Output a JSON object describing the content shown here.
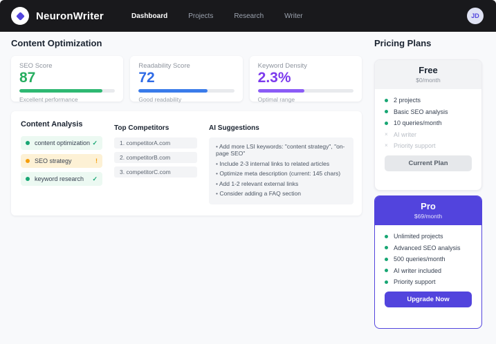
{
  "colors": {
    "accent": "#5244dd",
    "warn": "#f59e0b"
  },
  "navbar": {
    "brand": "NeuronWriter",
    "items": [
      {
        "label": "Dashboard",
        "active": true
      },
      {
        "label": "Projects",
        "active": false
      },
      {
        "label": "Research",
        "active": false
      },
      {
        "label": "Writer",
        "active": false
      }
    ],
    "avatar": "JD"
  },
  "main": {
    "title": "Content Optimization",
    "score_cards": [
      {
        "label": "SEO Score",
        "value": "87",
        "caption": "Excellent performance",
        "percent": 87,
        "bar_color": "#2eb872",
        "value_color": "#27ae60"
      },
      {
        "label": "Readability Score",
        "value": "72",
        "caption": "Good readability",
        "percent": 72,
        "bar_color": "#3a7bea",
        "value_color": "#2f6be6"
      },
      {
        "label": "Keyword Density",
        "value": "2.3%",
        "caption": "Optimal range",
        "percent": 49,
        "bar_color": "#8b5cf6",
        "value_color": "#7c3aed"
      }
    ],
    "analysis": {
      "title": "Content Analysis",
      "keywords": [
        {
          "label": "content optimization",
          "status": "ok",
          "marker": "✓"
        },
        {
          "label": "SEO strategy",
          "status": "warn",
          "marker": "!"
        },
        {
          "label": "keyword research",
          "status": "ok",
          "marker": "✓"
        }
      ],
      "competitors": {
        "title": "Top Competitors",
        "items": [
          "1. competitorA.com",
          "2. competitorB.com",
          "3. competitorC.com"
        ]
      },
      "suggestions": {
        "title": "AI Suggestions",
        "items": [
          "Add more LSI keywords: \"content strategy\", \"on-page SEO\"",
          "Include 2-3 internal links to related articles",
          "Optimize meta description (current: 145 chars)",
          "Add 1-2 relevant external links",
          "Consider adding a FAQ section"
        ]
      }
    }
  },
  "pricing": {
    "title": "Pricing Plans",
    "plans": [
      {
        "name": "Free",
        "price": "$0/month",
        "features": [
          {
            "label": "2 projects",
            "included": true
          },
          {
            "label": "Basic SEO analysis",
            "included": true
          },
          {
            "label": "10 queries/month",
            "included": true
          },
          {
            "label": "AI writer",
            "included": false,
            "marker": "×"
          },
          {
            "label": "Priority support",
            "included": false,
            "marker": "×"
          }
        ],
        "button": "Current Plan"
      },
      {
        "name": "Pro",
        "price": "$69/month",
        "features": [
          {
            "label": "Unlimited projects",
            "included": true
          },
          {
            "label": "Advanced SEO analysis",
            "included": true
          },
          {
            "label": "500 queries/month",
            "included": true
          },
          {
            "label": "AI writer included",
            "included": true
          },
          {
            "label": "Priority support",
            "included": true
          }
        ],
        "button": "Upgrade Now"
      }
    ]
  }
}
